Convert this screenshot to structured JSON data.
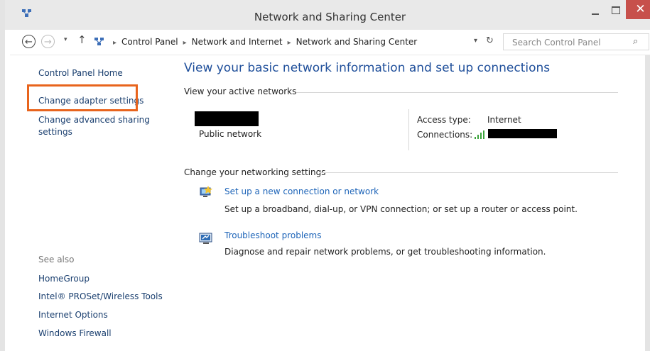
{
  "window": {
    "title": "Network and Sharing Center",
    "close_glyph": "✕"
  },
  "navigation": {
    "back_glyph": "←",
    "forward_glyph": "→",
    "recent_glyph": "▾",
    "up_glyph": "↑",
    "breadcrumb": [
      "Control Panel",
      "Network and Internet",
      "Network and Sharing Center"
    ],
    "separator": "▸",
    "dropdown_glyph": "▾",
    "refresh_glyph": "↻",
    "search_placeholder": "Search Control Panel",
    "search_glyph": "⌕"
  },
  "sidebar": {
    "home_link": "Control Panel Home",
    "links": [
      "Change adapter settings",
      "Change advanced sharing settings"
    ],
    "see_also_label": "See also",
    "see_also_links": [
      "HomeGroup",
      "Intel® PROSet/Wireless Tools",
      "Internet Options",
      "Windows Firewall"
    ]
  },
  "main": {
    "title": "View your basic network information and set up connections",
    "active_networks_header": "View your active networks",
    "network_type": "Public network",
    "access_type_label": "Access type:",
    "access_type_value": "Internet",
    "connections_label": "Connections:",
    "change_settings_header": "Change your networking settings",
    "settings": [
      {
        "icon": "new-connection-icon",
        "link": "Set up a new connection or network",
        "description": "Set up a broadband, dial-up, or VPN connection; or set up a router or access point."
      },
      {
        "icon": "troubleshoot-icon",
        "link": "Troubleshoot problems",
        "description": "Diagnose and repair network problems, or get troubleshooting information."
      }
    ]
  },
  "colors": {
    "highlight": "#e8641d",
    "link": "#1d64b8",
    "title": "#1e4e9a",
    "close_button": "#c7504b"
  }
}
